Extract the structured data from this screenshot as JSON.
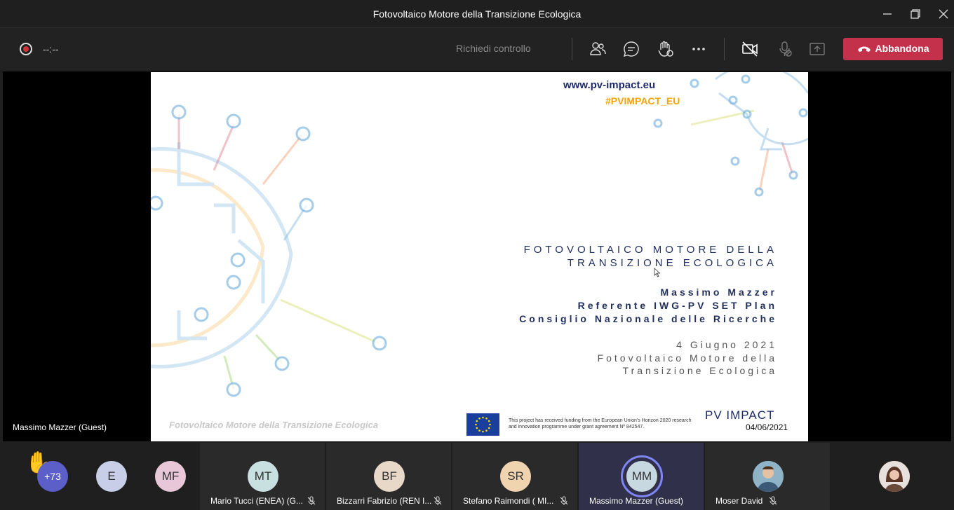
{
  "window": {
    "title": "Fotovoltaico Motore della Transizione Ecologica"
  },
  "toolbar": {
    "timer": "--:--",
    "request_control": "Richiedi controllo",
    "leave_label": "Abbandona"
  },
  "slide": {
    "url": "www.pv-impact.eu",
    "hashtag": "#PVIMPACT_EU",
    "title_line1": "FOTOVOLTAICO MOTORE DELLA",
    "title_line2": "TRANSIZIONE ECOLOGICA",
    "author": "Massimo Mazzer",
    "role": "Referente IWG-PV SET Plan",
    "institution": "Consiglio Nazionale delle Ricerche",
    "date_line": "4 Giugno 2021",
    "event_line1": "Fotovoltaico Motore della",
    "event_line2": "Transizione Ecologica",
    "footer_title": "Fotovoltaico Motore della Transizione Ecologica",
    "funding_text": "This project has received funding from the European Union's Horizon 2020 research and innovation programme under grant agreement Nº 842547.",
    "logo_text": "PV IMPACT",
    "footer_date": "04/06/2021"
  },
  "presenter": {
    "name": "Massimo Mazzer (Guest)"
  },
  "participants": {
    "overflow_count": "+73",
    "small": [
      {
        "initials": "E",
        "color": "#c8cde8"
      },
      {
        "initials": "MF",
        "color": "#e8c8d8"
      }
    ],
    "tiles": [
      {
        "initials": "MT",
        "name": "Mario Tucci (ENEA) (G...",
        "color": "#c8e0e0"
      },
      {
        "initials": "BF",
        "name": "Bizzarri Fabrizio (REN I...",
        "color": "#e8d8c8"
      },
      {
        "initials": "SR",
        "name": "Stefano Raimondi ( MI...",
        "color": "#f0d4b0"
      },
      {
        "initials": "MM",
        "name": "Massimo Mazzer (Guest)",
        "color": "#c8d8e0"
      },
      {
        "initials": "",
        "name": "Moser David",
        "color": "#7aa0b8"
      }
    ]
  }
}
